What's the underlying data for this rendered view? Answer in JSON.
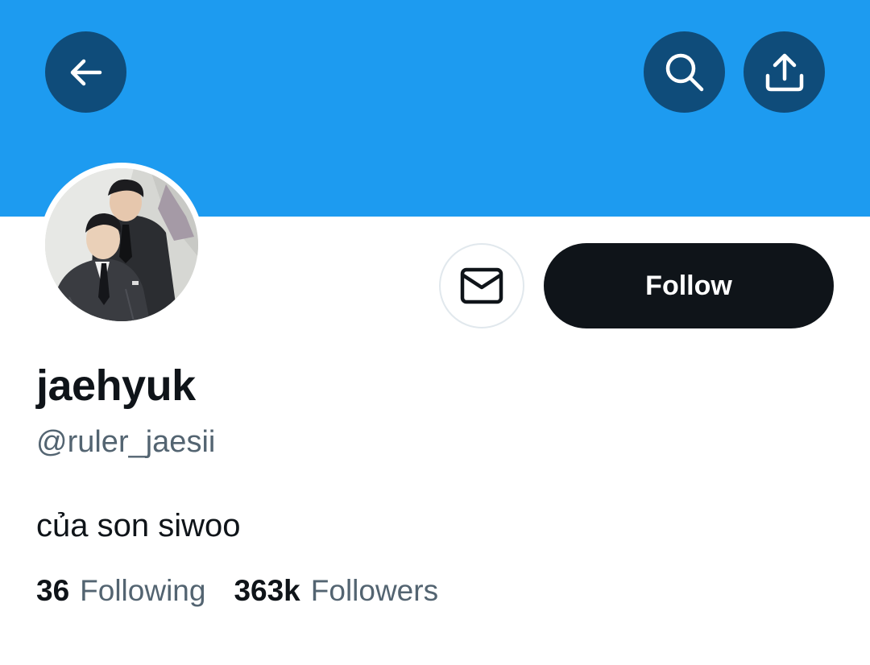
{
  "header": {
    "banner_color": "#1d9bf0",
    "back_icon": "arrow-left-icon",
    "search_icon": "search-icon",
    "share_icon": "share-icon"
  },
  "actions": {
    "message_icon": "envelope-icon",
    "follow_label": "Follow"
  },
  "profile": {
    "display_name": "jaehyuk",
    "handle": "@ruler_jaesii",
    "bio": "của son siwoo"
  },
  "stats": {
    "following_count": "36",
    "following_label": "Following",
    "followers_count": "363k",
    "followers_label": "Followers"
  }
}
